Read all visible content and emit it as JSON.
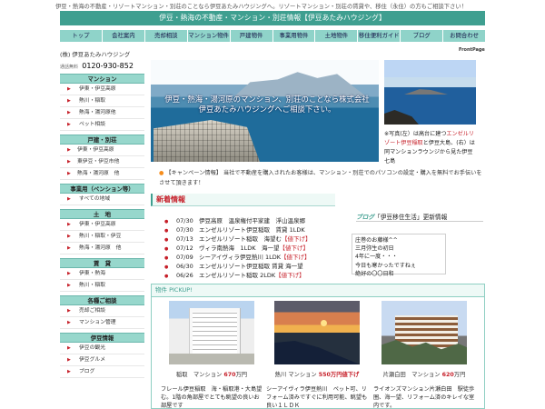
{
  "top_banner": "伊豆・熱海の不動産・リゾートマンション・別荘のことなら伊豆あたみハウジングへ。リゾートマンション・別荘の賃貸や、移住（永住）の方もご相談下さい！",
  "title_bar": "伊豆・熱海の不動産・マンション・別荘情報【伊豆あたみハウジング】",
  "nav_items": [
    "トップ",
    "会社案内",
    "売却相談",
    "マンション物件",
    "戸建物件",
    "事業用物件",
    "土地物件",
    "移住便利ガイド",
    "ブログ",
    "お問合わせ"
  ],
  "frontpage": "FrontPage",
  "company": "(株) 伊豆あたみハウジング",
  "phone_label": "通話無料",
  "phone": "0120-930-852",
  "side_sections": [
    {
      "title": "マンション",
      "items": [
        "伊東・伊豆高原",
        "熱川・稲取",
        "熱海・湯河原他",
        "ペット相談"
      ]
    },
    {
      "title": "戸建・別荘",
      "items": [
        "伊東・伊豆高原",
        "東伊豆・伊豆市他",
        "熱海・湯河原　他"
      ]
    },
    {
      "title": "事業用（ペンション等）",
      "items": [
        "すべての地域"
      ]
    },
    {
      "title": "土　地",
      "items": [
        "伊東・伊豆高原",
        "熱川・稲取・伊豆",
        "熱海・湯河原　他"
      ]
    },
    {
      "title": "賃　貸",
      "items": [
        "伊東・熱海",
        "熱川・稲取"
      ]
    },
    {
      "title": "各種ご相談",
      "items": [
        "売却ご相談",
        "マンション管理"
      ]
    },
    {
      "title": "伊豆情報",
      "items": [
        "伊豆の観光",
        "伊豆グルメ",
        "ブログ"
      ]
    }
  ],
  "hero_text": "伊豆・熱海・湯河原のマンション、別荘のことなら株式会社伊豆あたみハウジングへご相談下さい。",
  "photo_note": {
    "prefix": "※写真(左）は高台に建つ",
    "link": "エンゼルリゾート伊豆稲取",
    "suffix": "と伊豆大島、(右）は同マンションラウンジから見た伊豆七島"
  },
  "campaign": {
    "label": "【キャンペーン情報】",
    "text": "当社で不動産を購入されたお客様は、マンション・別荘でのパソコンの設定・購入を無料でお手伝いをさせて頂きます！"
  },
  "news_title": "新着情報",
  "news": [
    {
      "date": "07/30",
      "text": "伊豆高原　温泉権付平家建　浮山温泉郷",
      "tag": ""
    },
    {
      "date": "07/30",
      "text": "エンゼルリゾート伊豆稲取　賃貸 1LDK",
      "tag": ""
    },
    {
      "date": "07/13",
      "text": "エンゼルリゾート稲取　海望む",
      "tag": "【値下げ】"
    },
    {
      "date": "07/12",
      "text": "ヴィラ南熱海　1LDK　海一望",
      "tag": "【値下げ】"
    },
    {
      "date": "07/09",
      "text": "シーアイヴィラ伊豆熱川 1LDK",
      "tag": "【値下げ】"
    },
    {
      "date": "06/30",
      "text": "エンゼルリゾート伊豆稲取 賃貸 海一望",
      "tag": ""
    },
    {
      "date": "06/26",
      "text": "エンゼルリゾート稲取 2LDK",
      "tag": "【値下げ】"
    }
  ],
  "blog_header": {
    "prefix": "ブログ",
    "name": "「伊豆移住生活」",
    "suffix": "更新情報"
  },
  "blog_items": [
    "庄巻のお藤様^^",
    "三月弥生の初日",
    "4年に一度・・・",
    "今日も寒かったですねぇ",
    "絶好の〇〇日和"
  ],
  "pickup_title": "物件 PICKUP!",
  "properties": [
    {
      "area": "稲取　マンション",
      "price": "670",
      "unit": "万円",
      "desc": "フレール伊豆稲取　海・稲取港・大島望む。1階の角部屋でとても眺望の良いお部屋です"
    },
    {
      "area": "熱川 マンション",
      "price": "550",
      "unit": "万円値下げ",
      "desc": "シーアイヴィラ伊豆熱川　ペット可、リフォーム済みですぐに利用可能、眺望も良い１ＬＤＫ"
    },
    {
      "area": "片瀬白田　マンション",
      "price": "620",
      "unit": "万円",
      "desc": "ライオンズマンション片瀬白田　駅徒歩圏、海一望、リフォーム済のキレイな室内です。"
    }
  ]
}
